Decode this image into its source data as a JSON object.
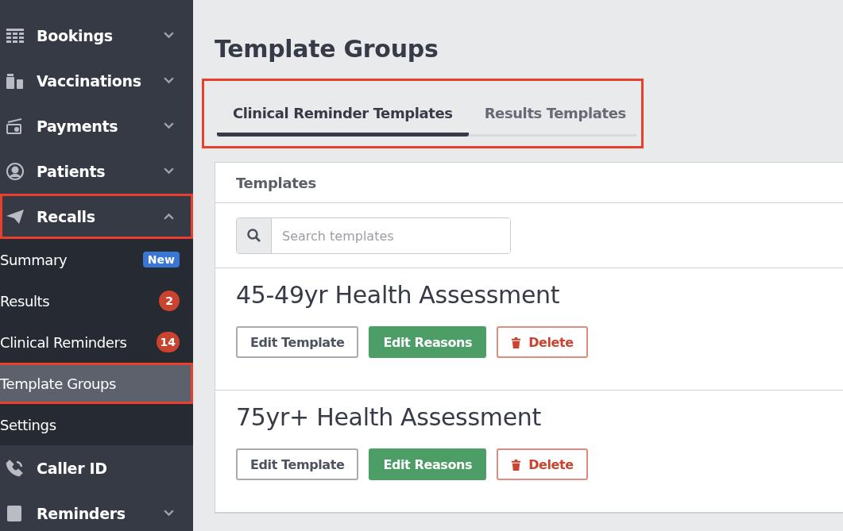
{
  "sidebar": {
    "items": [
      {
        "label": "Bookings",
        "kind": "group",
        "expanded": false,
        "highlighted": false
      },
      {
        "label": "Vaccinations",
        "kind": "group",
        "expanded": false,
        "highlighted": false
      },
      {
        "label": "Payments",
        "kind": "group",
        "expanded": false,
        "highlighted": false
      },
      {
        "label": "Patients",
        "kind": "group",
        "expanded": false,
        "highlighted": false
      },
      {
        "label": "Recalls",
        "kind": "group",
        "expanded": true,
        "highlighted": true,
        "children": [
          {
            "label": "Summary",
            "selected": false,
            "highlighted": false,
            "badge": {
              "text": "New",
              "kind": "new"
            }
          },
          {
            "label": "Results",
            "selected": false,
            "highlighted": false,
            "badge": {
              "text": "2",
              "kind": "count"
            }
          },
          {
            "label": "Clinical Reminders",
            "selected": false,
            "highlighted": false,
            "badge": {
              "text": "14",
              "kind": "count"
            }
          },
          {
            "label": "Template Groups",
            "selected": true,
            "highlighted": true
          },
          {
            "label": "Settings",
            "selected": false,
            "highlighted": false
          }
        ]
      },
      {
        "label": "Caller ID",
        "kind": "link",
        "highlighted": false
      },
      {
        "label": "Reminders",
        "kind": "group",
        "expanded": false,
        "highlighted": false
      }
    ]
  },
  "page": {
    "title": "Template Groups",
    "tabs_highlighted": true,
    "tabs": [
      {
        "label": "Clinical Reminder Templates",
        "selected": true
      },
      {
        "label": "Results Templates",
        "selected": false
      }
    ],
    "card": {
      "title": "Templates",
      "search": {
        "placeholder": "Search templates"
      },
      "templates": [
        {
          "name": "45-49yr Health Assessment",
          "buttons": [
            {
              "label": "Edit Template",
              "kind": "outline"
            },
            {
              "label": "Edit Reasons",
              "kind": "success"
            },
            {
              "label": "Delete",
              "kind": "danger"
            }
          ]
        },
        {
          "name": "75yr+ Health Assessment",
          "buttons": [
            {
              "label": "Edit Template",
              "kind": "outline"
            },
            {
              "label": "Edit Reasons",
              "kind": "success"
            },
            {
              "label": "Delete",
              "kind": "danger"
            }
          ]
        }
      ]
    }
  }
}
